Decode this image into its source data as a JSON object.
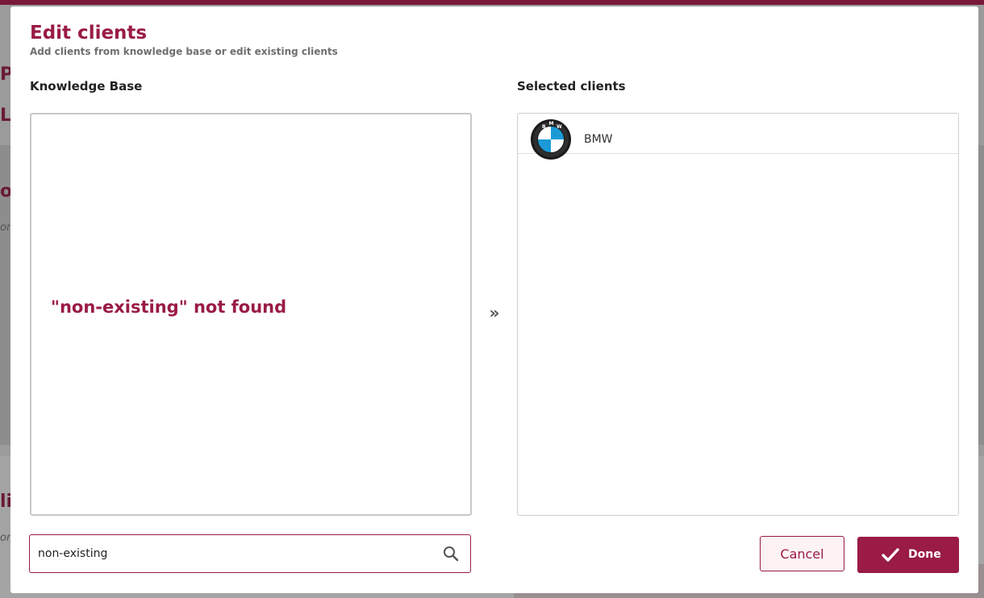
{
  "background": {
    "fragments": [
      "Pr",
      "Li",
      "o",
      "on",
      "li",
      "on"
    ]
  },
  "modal": {
    "title": "Edit clients",
    "subtitle": "Add clients from knowledge base or edit existing clients"
  },
  "knowledge_base": {
    "label": "Knowledge Base",
    "empty_message": "\"non-existing\" not found"
  },
  "transfer": {
    "symbol": "»",
    "icon": "double-chevron-right-icon"
  },
  "selected_clients": {
    "label": "Selected clients",
    "items": [
      {
        "name": "BMW",
        "logo": "bmw-logo"
      }
    ]
  },
  "search": {
    "value": "non-existing",
    "icon": "search-icon"
  },
  "actions": {
    "cancel_label": "Cancel",
    "done_label": "Done",
    "done_icon": "check-icon"
  },
  "colors": {
    "accent": "#9a1b45",
    "cancel_bg": "#fdf3f5",
    "border": "#c8c8c8",
    "bmw_blue": "#1c9ad6"
  }
}
